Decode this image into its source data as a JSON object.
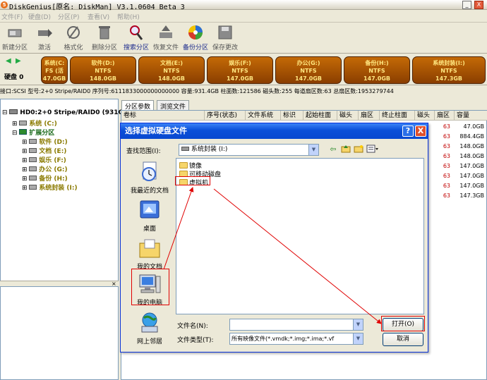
{
  "window": {
    "title": "DiskGenius[原名: DiskMan] V3.1.0604 Beta 3",
    "app_icon": "5",
    "min": "_",
    "close": "X"
  },
  "menu": [
    "文件(F)",
    "硬盘(D)",
    "分区(P)",
    "查看(V)",
    "帮助(H)"
  ],
  "toolbar": [
    "新建分区",
    "激活",
    "格式化",
    "删除分区",
    "搜索分区",
    "恢复文件",
    "备份分区",
    "保存更改"
  ],
  "disk": {
    "label": "硬盘 0",
    "partitions": [
      {
        "name": "系统(C:",
        "fs": "FS (活",
        "size": "47.0GB"
      },
      {
        "name": "软件(D:)",
        "fs": "NTFS",
        "size": "148.0GB"
      },
      {
        "name": "文档(E:)",
        "fs": "NTFS",
        "size": "148.0GB"
      },
      {
        "name": "娱乐(F:)",
        "fs": "NTFS",
        "size": "147.0GB"
      },
      {
        "name": "办公(G:)",
        "fs": "NTFS",
        "size": "147.0GB"
      },
      {
        "name": "备份(H:)",
        "fs": "NTFS",
        "size": "147.0GB"
      },
      {
        "name": "系统封装(I:)",
        "fs": "NTFS",
        "size": "147.3GB"
      }
    ],
    "info": "接口:SCSI  型号:2+0 Stripe/RAID0  序列号:6111833000000000000  容量:931.4GB  柱面数:121586  磁头数:255  每道扇区数:63  总扇区数:1953279744"
  },
  "tree": {
    "root": "HD0:2+0 Stripe/RAID0 (931G",
    "items": [
      "系统 (C:)",
      "扩展分区",
      "软件 (D:)",
      "文档 (E:)",
      "娱乐 (F:)",
      "办公 (G:)",
      "备份 (H:)",
      "系统封装 (I:)"
    ]
  },
  "tabs": [
    "分区参数",
    "浏览文件"
  ],
  "grid": {
    "columns": [
      "卷标",
      "序号(状态)",
      "文件系统",
      "标识",
      "起始柱面",
      "磁头",
      "扇区",
      "终止柱面",
      "磁头",
      "扇区",
      "容量"
    ],
    "sectors": [
      "63",
      "63",
      "63",
      "63",
      "63",
      "63",
      "63",
      "63"
    ],
    "sizes": [
      "47.0GB",
      "884.4GB",
      "148.0GB",
      "148.0GB",
      "147.0GB",
      "147.0GB",
      "147.0GB",
      "147.3GB"
    ]
  },
  "dialog": {
    "title": "选择虚拟硬盘文件",
    "help": "?",
    "close": "X",
    "lookin_label": "查找范围(I):",
    "lookin_value": "系统封装  (I:)",
    "places": [
      "我最近的文档",
      "桌面",
      "我的文档",
      "我的电脑",
      "网上邻居"
    ],
    "files": [
      "镜像",
      "可移动磁盘",
      "虚拟机"
    ],
    "filename_label": "文件名(N):",
    "filename_value": "",
    "filetype_label": "文件类型(T):",
    "filetype_value": "所有映像文件(*.vmdk;*.img;*.ima;*.vf",
    "open": "打开(O)",
    "cancel": "取消"
  },
  "colors": {
    "partition": "#b35a05",
    "partition_text": "#ffe680",
    "dialog_title": "#0a4fd8",
    "annotation": "#e00000"
  }
}
